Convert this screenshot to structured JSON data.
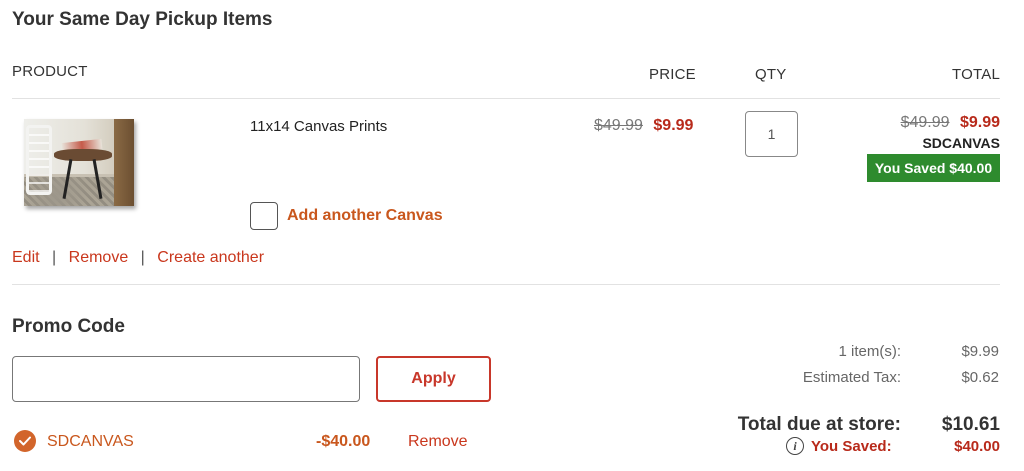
{
  "section": {
    "title": "Your Same Day Pickup Items"
  },
  "table": {
    "headers": {
      "product": "PRODUCT",
      "price": "PRICE",
      "qty": "QTY",
      "total": "TOTAL"
    }
  },
  "item": {
    "name": "11x14 Canvas Prints",
    "original_price": "$49.99",
    "sale_price": "$9.99",
    "quantity": "1",
    "total_original": "$49.99",
    "total_sale": "$9.99",
    "promo_code": "SDCANVAS",
    "saved_badge": "You Saved $40.00",
    "add_another_label": "Add another Canvas",
    "actions": {
      "edit": "Edit",
      "remove": "Remove",
      "create_another": "Create another",
      "separator": "|"
    }
  },
  "promo": {
    "title": "Promo Code",
    "input_value": "",
    "input_placeholder": "",
    "apply_label": "Apply",
    "applied_code": "SDCANVAS",
    "applied_discount": "-$40.00",
    "remove_label": "Remove"
  },
  "summary": {
    "items_label": "1 item(s):",
    "items_value": "$9.99",
    "tax_label": "Estimated Tax:",
    "tax_value": "$0.62",
    "total_label": "Total due at store:",
    "total_value": "$10.61",
    "saved_label": "You Saved:",
    "saved_value": "$40.00",
    "info_icon_glyph": "i"
  },
  "colors": {
    "accent_red": "#b82a1b",
    "accent_orange": "#c9571d",
    "badge_green": "#2e8b2e"
  }
}
